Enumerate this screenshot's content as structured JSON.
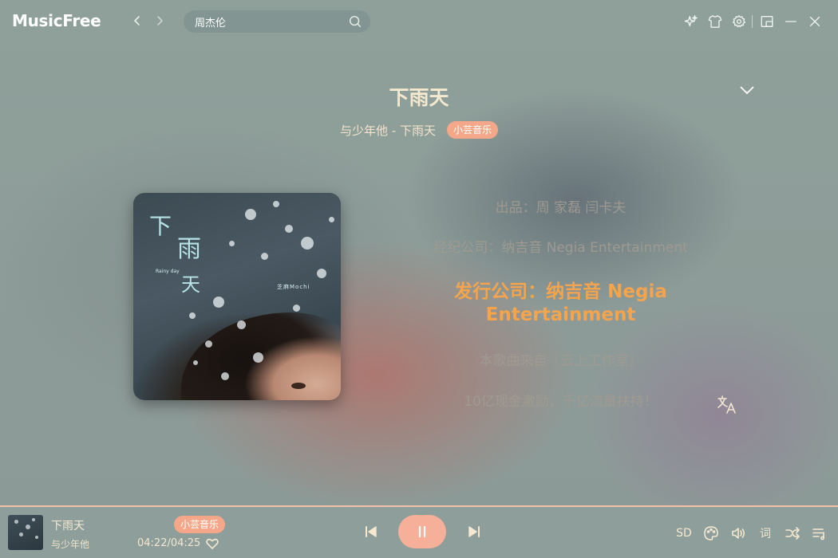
{
  "app": {
    "name": "MusicFree"
  },
  "search": {
    "value": "周杰伦"
  },
  "toolbar": {
    "icons": [
      "sparkle-icon",
      "shirt-icon",
      "gear-icon",
      "minimize-to-mini-icon",
      "minimize-icon",
      "close-icon"
    ]
  },
  "song": {
    "title": "下雨天",
    "artist_line": "与少年他 - 下雨天",
    "source": "小芸音乐"
  },
  "cover": {
    "title_chars": [
      "下",
      "雨",
      "天"
    ],
    "rainy": "Rainy day",
    "artist": "芝麻Mochi"
  },
  "lyrics": [
    {
      "text": "出品：周 家磊 闫卡夫",
      "active": false
    },
    {
      "text": "经纪公司：纳吉音 Negia Entertainment",
      "active": false
    },
    {
      "text": "发行公司：纳吉音 Negia Entertainment",
      "active": true
    },
    {
      "text": "本歌曲来自〖云上工作室〗",
      "active": false
    },
    {
      "text": "10亿现金激励，千亿流量扶持！",
      "active": false
    }
  ],
  "player": {
    "title": "下雨天",
    "artist": "与少年他",
    "source": "小芸音乐",
    "time": "04:22/04:25",
    "quality": "SD",
    "lyric_btn": "词",
    "progress": 0.988,
    "state": "playing"
  },
  "colors": {
    "accent": "#f5a44e",
    "badge": "#f5a889",
    "play": "#f6b09a"
  }
}
